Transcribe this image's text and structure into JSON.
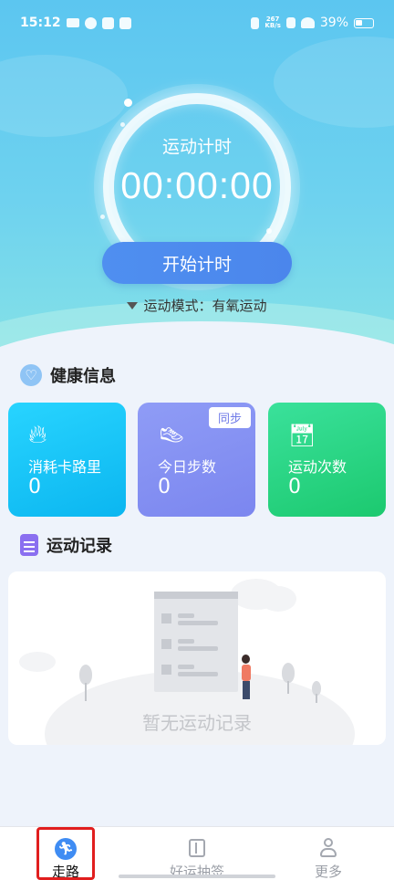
{
  "status_bar": {
    "time": "15:12",
    "network_speed_value": "267",
    "network_speed_unit": "KB/s",
    "battery": "39%"
  },
  "timer": {
    "label": "运动计时",
    "value": "00:00:00",
    "start_button": "开始计时",
    "mode_text": "运动模式：有氧运动"
  },
  "health": {
    "title": "健康信息",
    "cards": [
      {
        "label": "消耗卡路里",
        "value": "0",
        "icon": "flame-icon",
        "color": "#0bb6f0"
      },
      {
        "label": "今日步数",
        "value": "0",
        "icon": "shoe-icon",
        "badge": "同步",
        "color": "#7b86ef"
      },
      {
        "label": "运动次数",
        "value": "0",
        "icon": "calendar-plus-icon",
        "color": "#1cc96f"
      }
    ]
  },
  "records": {
    "title": "运动记录",
    "empty_text": "暂无运动记录"
  },
  "bottom_nav": {
    "items": [
      {
        "label": "走路",
        "icon": "walk-icon",
        "active": true
      },
      {
        "label": "好运抽签",
        "icon": "book-icon",
        "active": false
      },
      {
        "label": "更多",
        "icon": "user-icon",
        "active": false
      }
    ]
  },
  "colors": {
    "accent_blue": "#4b86ec",
    "highlight_red": "#e11e1e"
  }
}
